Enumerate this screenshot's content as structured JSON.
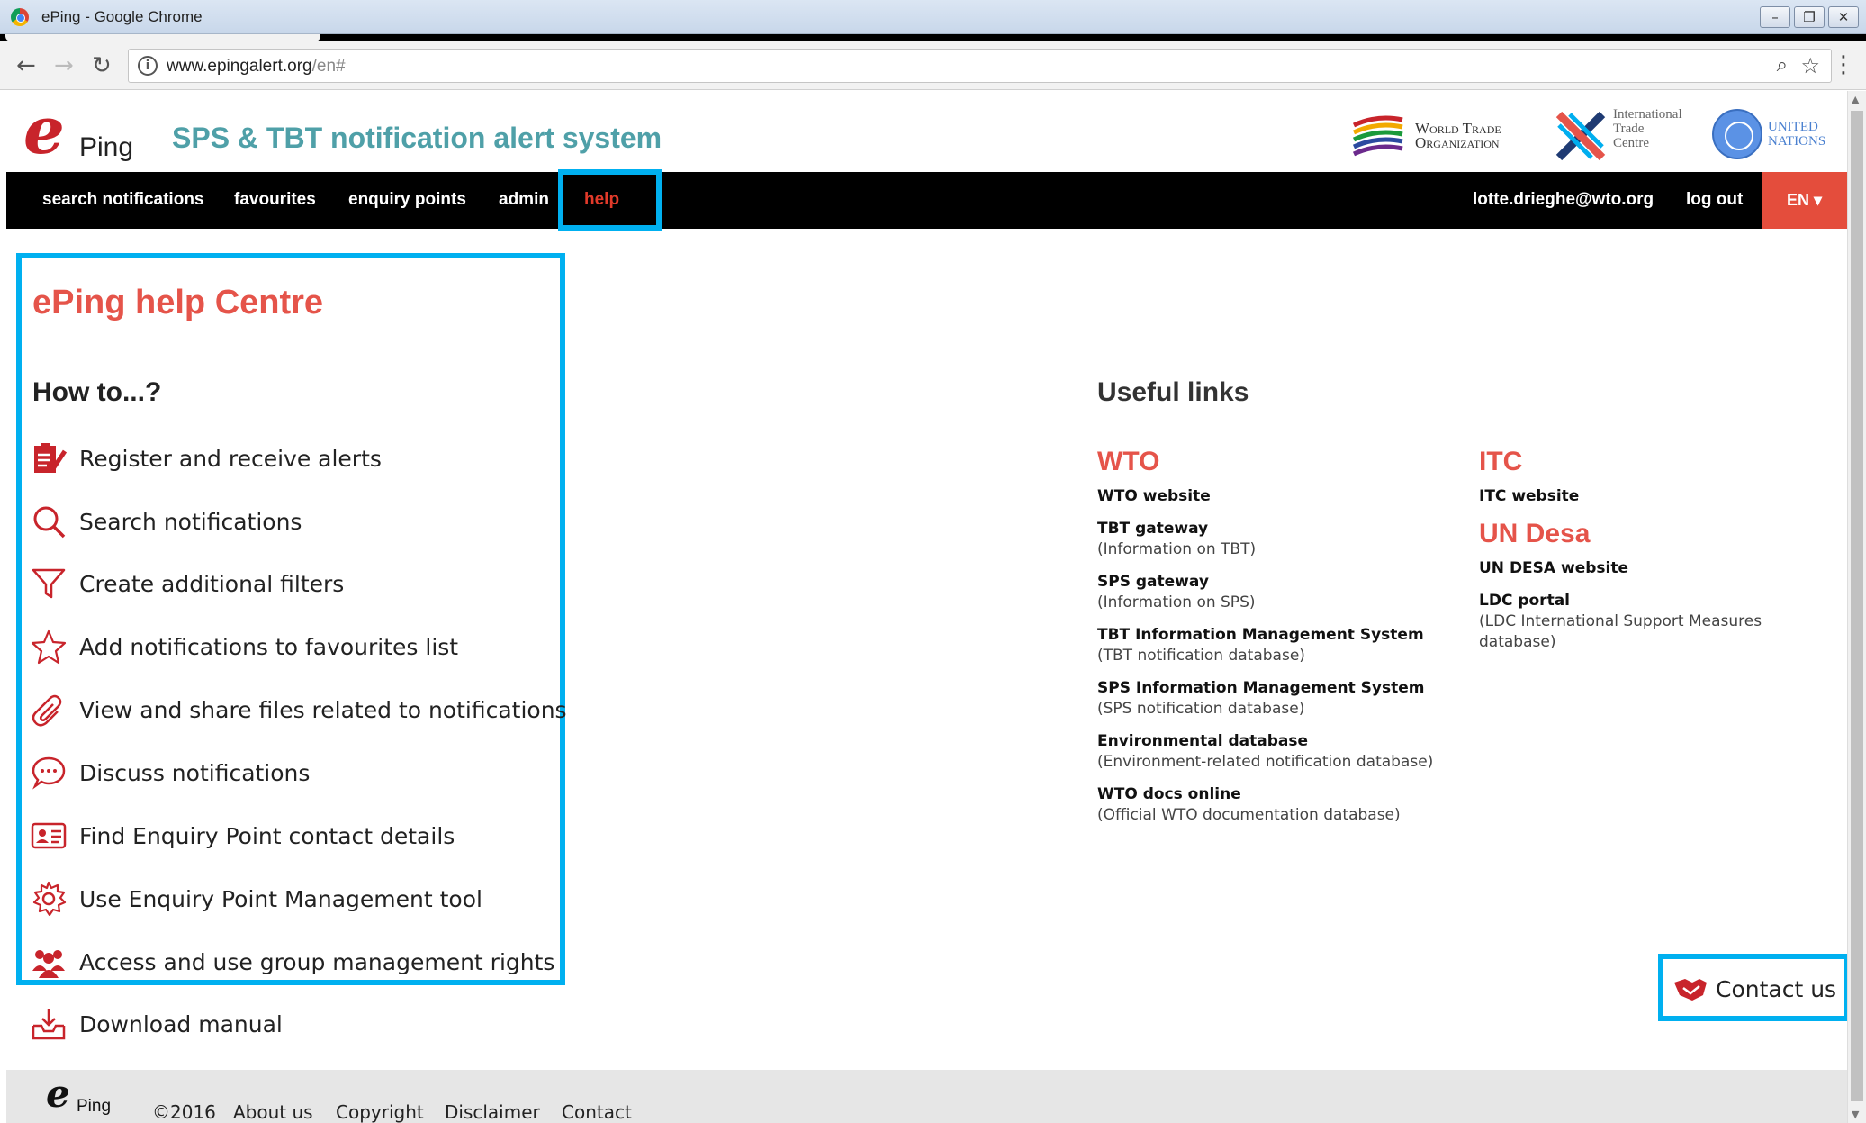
{
  "window": {
    "title": "ePing - Google Chrome",
    "buttons": [
      "–",
      "❐",
      "✕"
    ]
  },
  "browser": {
    "url_host": "www.epingalert.org",
    "url_rest": "/en#"
  },
  "site": {
    "logo_letter": "e",
    "logo_text": "Ping",
    "title": "SPS & TBT notification alert system",
    "partners": {
      "wto_line1": "World Trade",
      "wto_line2": "Organization",
      "itc_line1": "International",
      "itc_line2": "Trade",
      "itc_line3": "Centre",
      "un_line1": "UNITED",
      "un_line2": "NATIONS"
    }
  },
  "nav": {
    "items": [
      "search notifications",
      "favourites",
      "enquiry points",
      "admin",
      "help"
    ],
    "active": "help",
    "user": "lotte.drieghe@wto.org",
    "logout": "log out",
    "language": "EN ▾"
  },
  "help": {
    "title": "ePing help Centre",
    "howto_heading": "How to...?",
    "items": [
      {
        "label": "Register and receive alerts",
        "icon": "clipboard-edit-icon"
      },
      {
        "label": "Search notifications",
        "icon": "search-icon"
      },
      {
        "label": "Create additional filters",
        "icon": "filter-icon"
      },
      {
        "label": "Add notifications to favourites list",
        "icon": "star-icon"
      },
      {
        "label": "View and share files related to notifications",
        "icon": "paperclip-icon"
      },
      {
        "label": "Discuss notifications",
        "icon": "chat-bubble-icon"
      },
      {
        "label": "Find Enquiry Point contact details",
        "icon": "contact-card-icon"
      },
      {
        "label": "Use Enquiry Point Management tool",
        "icon": "gear-icon"
      },
      {
        "label": "Access and use group management rights",
        "icon": "group-icon"
      },
      {
        "label": "Download manual",
        "icon": "download-tray-icon"
      }
    ]
  },
  "useful_links": {
    "heading": "Useful links",
    "wto": {
      "title": "WTO",
      "links": [
        {
          "title": "WTO website",
          "desc": ""
        },
        {
          "title": "TBT gateway",
          "desc": "(Information on TBT)"
        },
        {
          "title": "SPS gateway",
          "desc": "(Information on SPS)"
        },
        {
          "title": "TBT Information Management System",
          "desc": "(TBT notification database)"
        },
        {
          "title": "SPS Information Management System",
          "desc": "(SPS notification database)"
        },
        {
          "title": "Environmental database",
          "desc": "(Environment-related notification database)"
        },
        {
          "title": "WTO docs online",
          "desc": "(Official WTO documentation database)"
        }
      ]
    },
    "itc": {
      "title": "ITC",
      "links": [
        {
          "title": "ITC website",
          "desc": ""
        }
      ]
    },
    "undesa": {
      "title": "UN Desa",
      "links": [
        {
          "title": "UN DESA website",
          "desc": ""
        },
        {
          "title": "LDC portal",
          "desc": "(LDC International Support Measures database)"
        }
      ]
    }
  },
  "contact_button": {
    "label": "Contact us",
    "icon": "handshake-icon"
  },
  "footer": {
    "logo_letter": "e",
    "logo_text": "Ping",
    "copyright": "©2016",
    "links": [
      "About us",
      "Copyright",
      "Disclaimer",
      "Contact"
    ]
  },
  "colors": {
    "accent_red": "#e5544a",
    "teal_title": "#4fa0a8",
    "highlight_blue": "#00b0f0",
    "nav_bg": "#000000"
  }
}
